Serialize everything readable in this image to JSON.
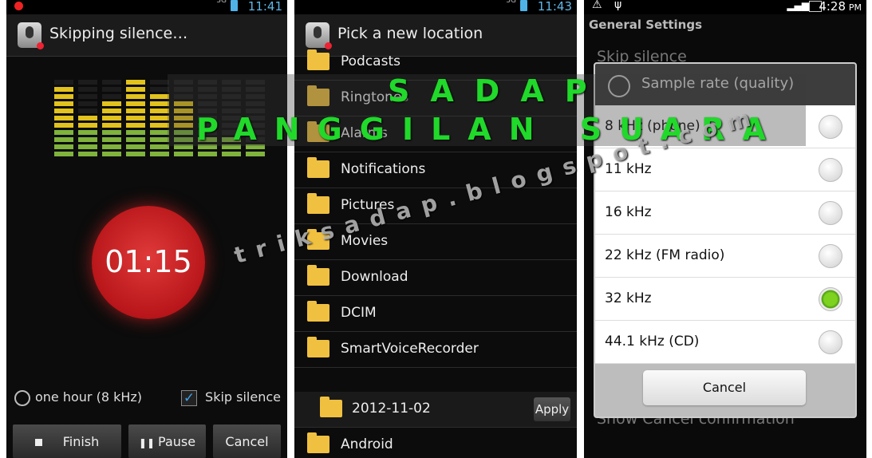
{
  "phone1": {
    "time": "11:41",
    "title": "Skipping silence…",
    "timer": "01:15",
    "duration_label": "one hour (8 kHz)",
    "skip_silence_label": "Skip silence",
    "skip_silence_checked": true,
    "buttons": {
      "finish": "Finish",
      "pause": "Pause",
      "cancel": "Cancel"
    }
  },
  "phone2": {
    "time": "11:43",
    "title": "Pick a new location",
    "folders": [
      "Podcasts",
      "Ringtones",
      "Alarms",
      "Notifications",
      "Pictures",
      "Movies",
      "Download",
      "DCIM",
      "SmartVoiceRecorder"
    ],
    "subfolder": "2012-11-02",
    "apply_label": "Apply",
    "last_folder": "Android"
  },
  "phone3": {
    "time": "4:28",
    "ampm": "PM",
    "section": "General Settings",
    "bg_item_top": "Skip silence",
    "bg_item_bottom": "Show Cancel confirmation",
    "dialog": {
      "title": "Sample rate (quality)",
      "options": [
        "8 kHz (phone)",
        "11 kHz",
        "16 kHz",
        "22 kHz (FM radio)",
        "32 kHz",
        "44.1 kHz (CD)"
      ],
      "selected_index": 4,
      "cancel_label": "Cancel"
    }
  },
  "watermark": {
    "line1": "SADAP",
    "line2": "PANGGILAN SUARA",
    "url": "triksadap.blogspot.com",
    "color": "#20d92a"
  }
}
